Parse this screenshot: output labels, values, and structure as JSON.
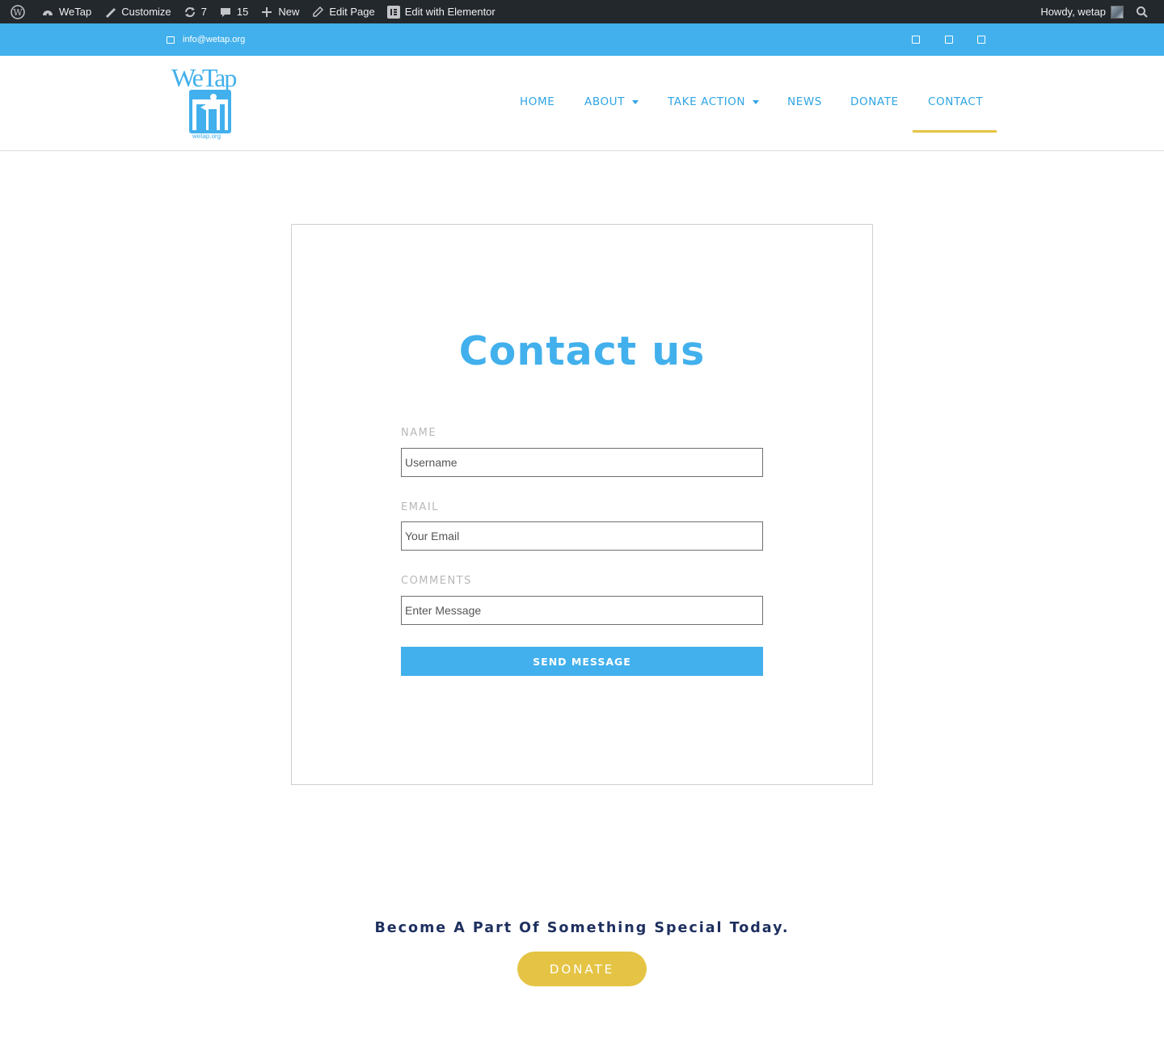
{
  "admin_bar": {
    "site_name": "WeTap",
    "customize": "Customize",
    "updates_count": "7",
    "comments_count": "15",
    "new_label": "New",
    "edit_page": "Edit Page",
    "edit_elementor": "Edit with Elementor",
    "howdy": "Howdy, wetap"
  },
  "top_strip": {
    "email": "info@wetap.org"
  },
  "logo": {
    "wordmark": "WeTap",
    "url": "wetap.org"
  },
  "nav": {
    "home": "HOME",
    "about": "ABOUT",
    "take_action": "TAKE ACTION",
    "news": "NEWS",
    "donate": "DONATE",
    "contact": "CONTACT"
  },
  "contact_form": {
    "title": "Contact us",
    "name_label": "NAME",
    "name_placeholder": "Username",
    "email_label": "EMAIL",
    "email_placeholder": "Your Email",
    "comments_label": "COMMENTS",
    "comments_placeholder": "Enter Message",
    "submit_label": "SEND MESSAGE"
  },
  "cta": {
    "tagline": "Become A Part Of Something Special Today.",
    "donate_label": "DONATE"
  },
  "colors": {
    "brand_blue": "#42b0ec",
    "accent_yellow": "#e5c445",
    "navy": "#1e2f5f",
    "admin_bar": "#23282d"
  }
}
